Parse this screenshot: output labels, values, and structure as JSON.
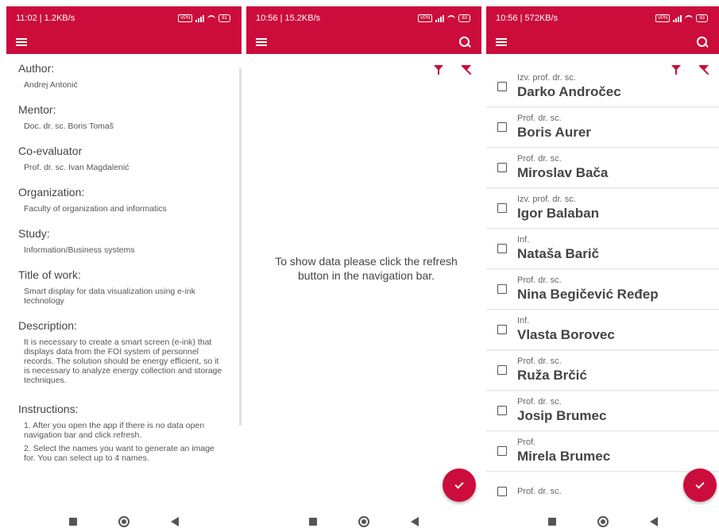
{
  "phones": [
    {
      "status_time": "11:02 | 1.2KB/s",
      "vpn": "VPN",
      "battery": "81"
    },
    {
      "status_time": "10:56 | 15.2KB/s",
      "vpn": "VPN",
      "battery": "83"
    },
    {
      "status_time": "10:56 | 572KB/s",
      "vpn": "VPN",
      "battery": "83"
    }
  ],
  "details": {
    "author_label": "Author:",
    "author_value": "Andrej Antonić",
    "mentor_label": "Mentor:",
    "mentor_value": "Doc. dr. sc. Boris Tomaš",
    "coeval_label": "Co-evaluator",
    "coeval_value": "Prof. dr. sc. Ivan Magdalenić",
    "org_label": "Organization:",
    "org_value": "Faculty of organization and informatics",
    "study_label": "Study:",
    "study_value": "Information/Business systems",
    "title_label": "Title of work:",
    "title_value": "Smart display for data visualization using e-ink technology",
    "desc_label": "Description:",
    "desc_value": "It is necessary to create a smart screen (e-ink) that displays data from the FOI system of personnel records. The solution should be energy efficient, so it is necessary to analyze energy collection and storage techniques.",
    "instr_label": "Instructions:",
    "instr_1": "1. After you open the app if there is no data open navigation bar and click refresh.",
    "instr_2": "2. Select the names you want to generate an image for. You can select up to 4 names."
  },
  "empty_message": "To show data please click the refresh button in the navigation bar.",
  "people": [
    {
      "title": "Izv. prof. dr. sc.",
      "name": "Darko Andročec"
    },
    {
      "title": "Prof. dr. sc.",
      "name": "Boris Aurer"
    },
    {
      "title": "Prof. dr. sc.",
      "name": "Miroslav Bača"
    },
    {
      "title": "Izv. prof. dr. sc.",
      "name": "Igor Balaban"
    },
    {
      "title": "Inf.",
      "name": "Nataša Barič"
    },
    {
      "title": "Prof. dr. sc.",
      "name": "Nina Begičević Ređep"
    },
    {
      "title": "Inf.",
      "name": "Vlasta Borovec"
    },
    {
      "title": "Prof. dr. sc.",
      "name": "Ruža Brčić"
    },
    {
      "title": "Prof. dr. sc.",
      "name": "Josip Brumec"
    },
    {
      "title": "Prof.",
      "name": "Mirela Brumec"
    },
    {
      "title": "Prof. dr. sc.",
      "name": ""
    }
  ],
  "colors": {
    "primary": "#cc0c3b"
  }
}
